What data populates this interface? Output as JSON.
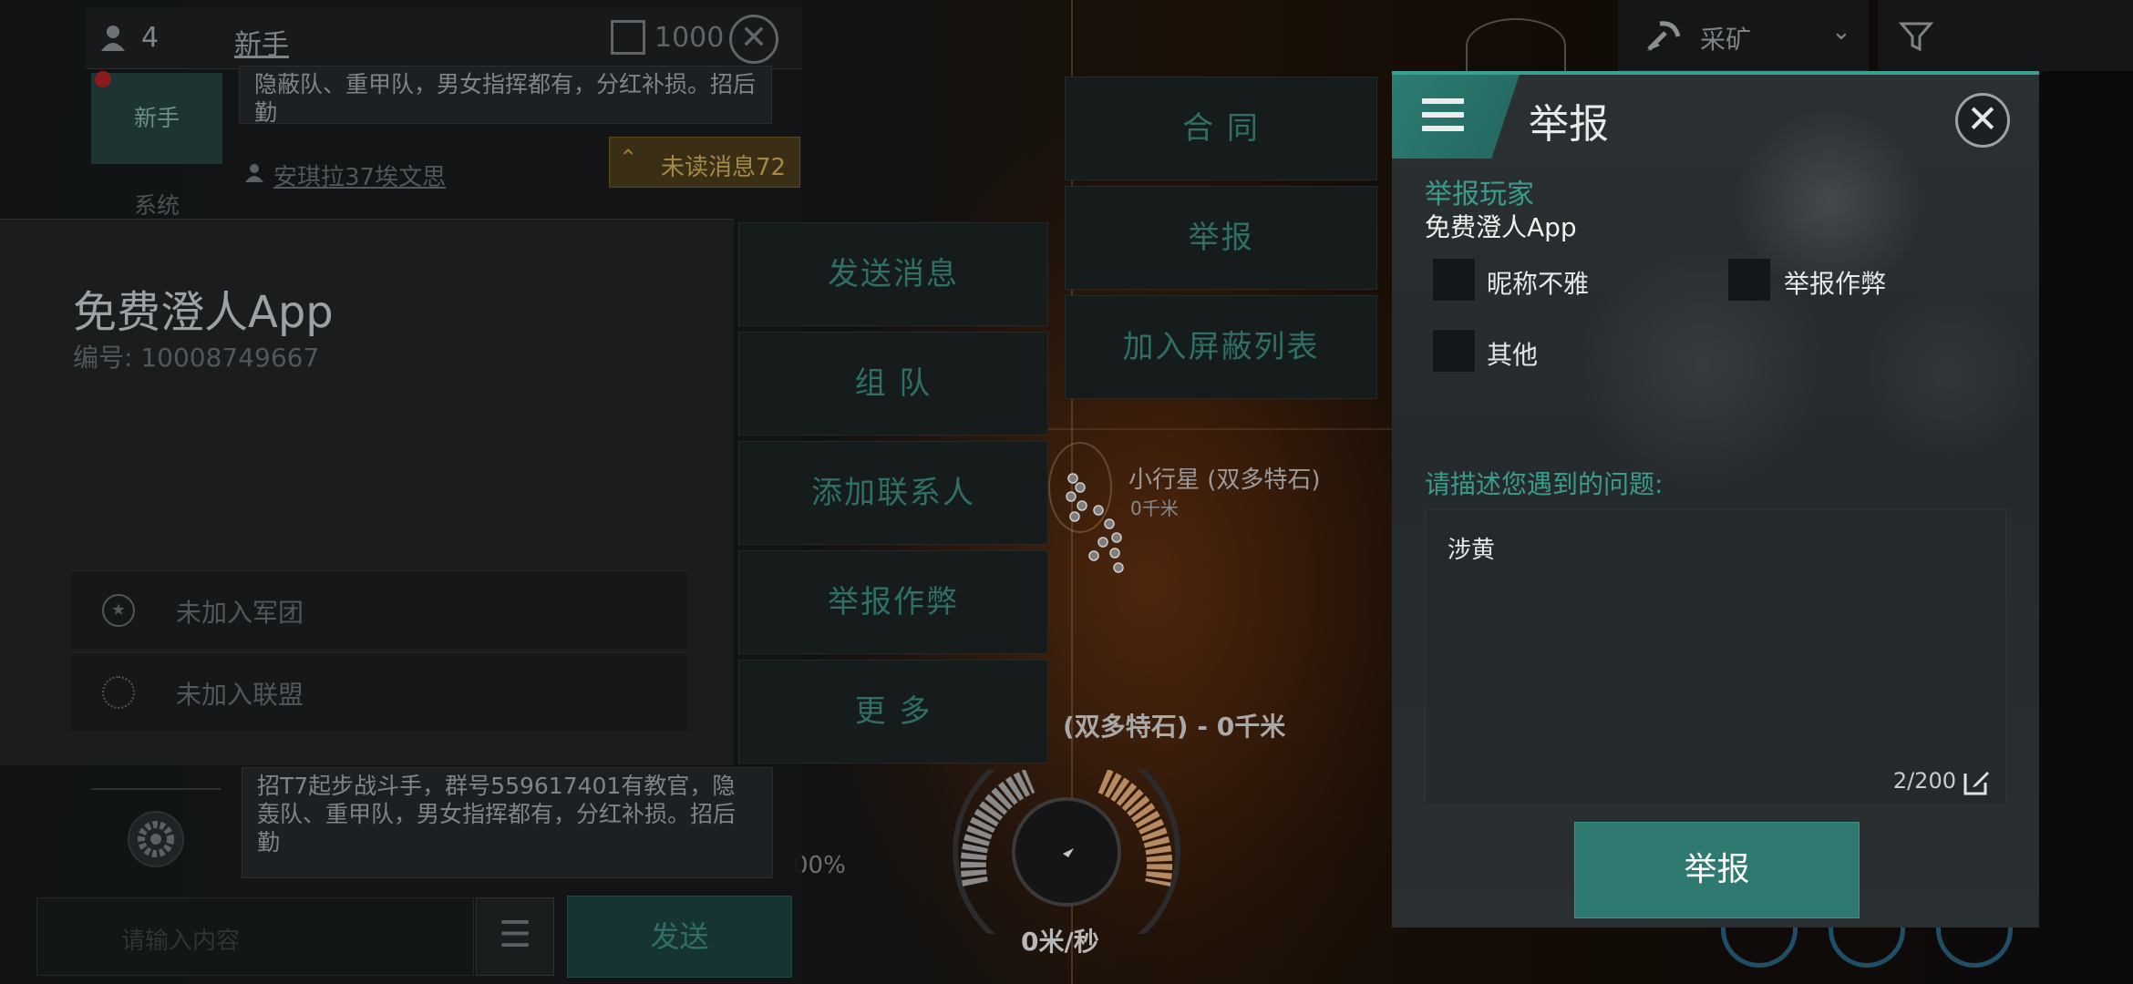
{
  "chat": {
    "member_count": "4",
    "channel_name": "新手",
    "currency_amount": "1000",
    "tab_newbie": "新手",
    "tab_system": "系统",
    "top_message_fragment": "隐蔽队、重甲队，男女指挥都有，分红补损。招后勤",
    "sender_name": "安琪拉37埃文思",
    "unread_label": "未读消息72",
    "bottom_message": "招T7起步战斗手，群号559617401有教官，隐轰队、重甲队，男女指挥都有，分红补损。招后勤",
    "input_placeholder": "请输入内容",
    "send_label": "发送"
  },
  "player_card": {
    "name": "免费澄人App",
    "id_label": "编号: 10008749667",
    "corp_status": "未加入军团",
    "alliance_status": "未加入联盟"
  },
  "action_menu": {
    "send_message": "发送消息",
    "team": "组 队",
    "add_contact": "添加联系人",
    "report_cheat": "举报作弊",
    "more": "更 多",
    "contract": "合 同",
    "report": "举报",
    "block": "加入屏蔽列表"
  },
  "scene": {
    "target_name": "小行星 (双多特石)",
    "target_distance": "0千米",
    "target_caption": "(双多特石) - 0千米",
    "speed": "0米/秒",
    "percent": "00%",
    "mining_filter": "采矿"
  },
  "report_dialog": {
    "title": "举报",
    "report_player_label": "举报玩家",
    "player_name": "免费澄人App",
    "options": [
      "昵称不雅",
      "举报作弊",
      "其他"
    ],
    "describe_label": "请描述您遇到的问题:",
    "description_value": "涉黄",
    "char_count": "2/200",
    "submit_label": "举报"
  },
  "colors": {
    "accent": "#3aa091",
    "button": "#2e7a70",
    "dim_text": "#4f585c"
  }
}
